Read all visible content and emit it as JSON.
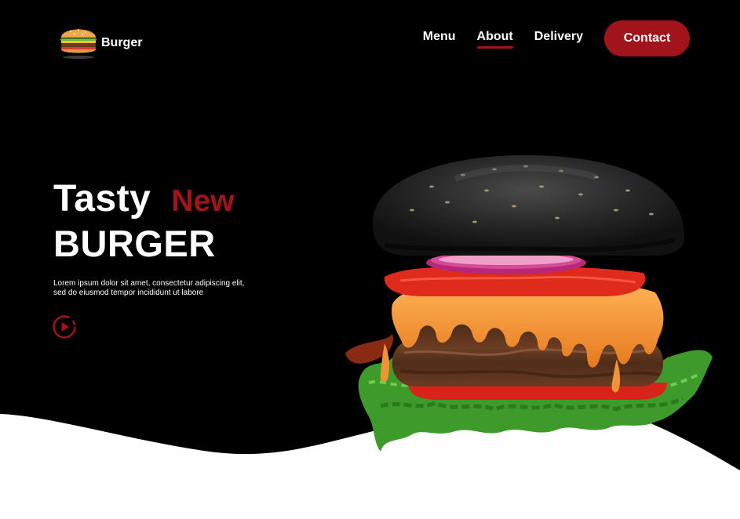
{
  "brand": {
    "name": "Burger",
    "logo_icon": "burger-icon"
  },
  "nav": {
    "items": [
      {
        "label": "Menu",
        "active": false
      },
      {
        "label": "About",
        "active": true
      },
      {
        "label": "Delivery",
        "active": false
      }
    ],
    "contact_label": "Contact"
  },
  "hero": {
    "title_word1": "Tasty",
    "title_word2": "New",
    "title_line2": "BURGER",
    "description": "Lorem ipsum dolor sit amet, consectetur adipiscing elit, sed do eiusmod tempor incididunt ut labore",
    "play_icon": "play-circle-icon"
  },
  "colors": {
    "background": "#000000",
    "accent": "#a2141b",
    "text": "#ffffff",
    "lower_background": "#ffffff"
  }
}
